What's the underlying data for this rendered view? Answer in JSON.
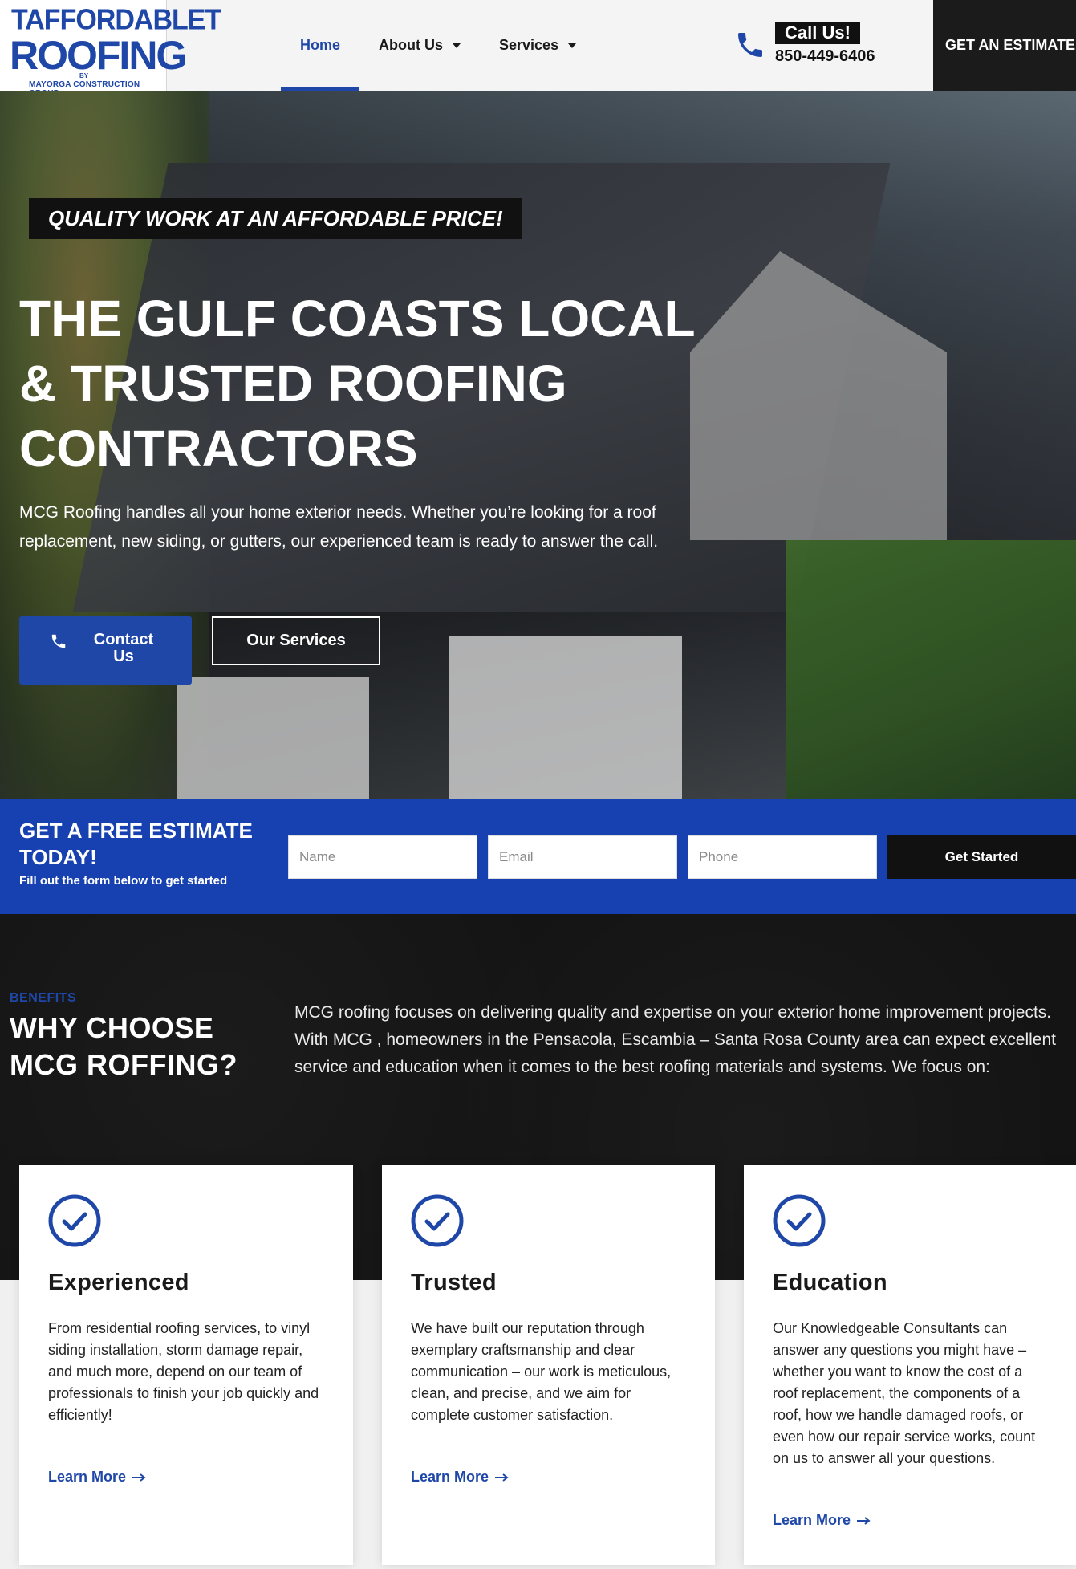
{
  "header": {
    "logo": {
      "line1": "TAFFORDABLET",
      "line2": "ROOFING",
      "by": "BY",
      "line3": "MAYORGA CONSTRUCTION GROUP"
    },
    "nav": {
      "home": "Home",
      "about": "About Us",
      "services": "Services"
    },
    "call": {
      "label": "Call Us!",
      "number": "850-449-6406",
      "icon": "phone-icon"
    },
    "estimate_button": "GET AN ESTIMATE"
  },
  "hero": {
    "tagline": "QUALITY WORK AT AN AFFORDABLE PRICE!",
    "title": "THE GULF COASTS LOCAL & TRUSTED ROOFING CONTRACTORS",
    "subtitle": "MCG Roofing handles all your home exterior needs. Whether you’re looking for a roof replacement, new siding, or gutters, our experienced team is ready to answer the call.",
    "contact_button": "Contact Us",
    "services_button": "Our Services"
  },
  "estimate_form": {
    "title": "GET A FREE ESTIMATE TODAY!",
    "subtitle": "Fill out the form below to get started",
    "name_placeholder": "Name",
    "email_placeholder": "Email",
    "phone_placeholder": "Phone",
    "submit": "Get Started"
  },
  "benefits": {
    "eyebrow": "BENEFITS",
    "title": "WHY CHOOSE MCG ROFFING?",
    "text": "MCG roofing focuses on delivering quality and expertise on your exterior home improvement projects. With MCG , homeowners in the Pensacola, Escambia – Santa Rosa County area can expect excellent service and education when it comes to the best roofing materials and systems. We focus on:"
  },
  "cards": [
    {
      "title": "Experienced",
      "text": "From residential roofing services, to vinyl siding installation, storm damage repair, and much more, depend on our team of professionals to finish your job quickly and efficiently!",
      "link": "Learn More"
    },
    {
      "title": "Trusted",
      "text": "We have built our reputation through exemplary craftsmanship and clear communication – our work is meticulous, clean, and precise, and we aim for complete customer satisfaction.",
      "link": "Learn More"
    },
    {
      "title": "Education",
      "text": "Our Knowledgeable Consultants can answer any questions you might have – whether you want to know the cost of a roof replacement, the components of a roof, how we handle damaged roofs, or even how our repair service works, count on us to answer all your questions.",
      "link": "Learn More"
    }
  ],
  "colors": {
    "brand_blue": "#1f47a8",
    "estimate_bar": "#1740b0",
    "dark": "#141414"
  }
}
